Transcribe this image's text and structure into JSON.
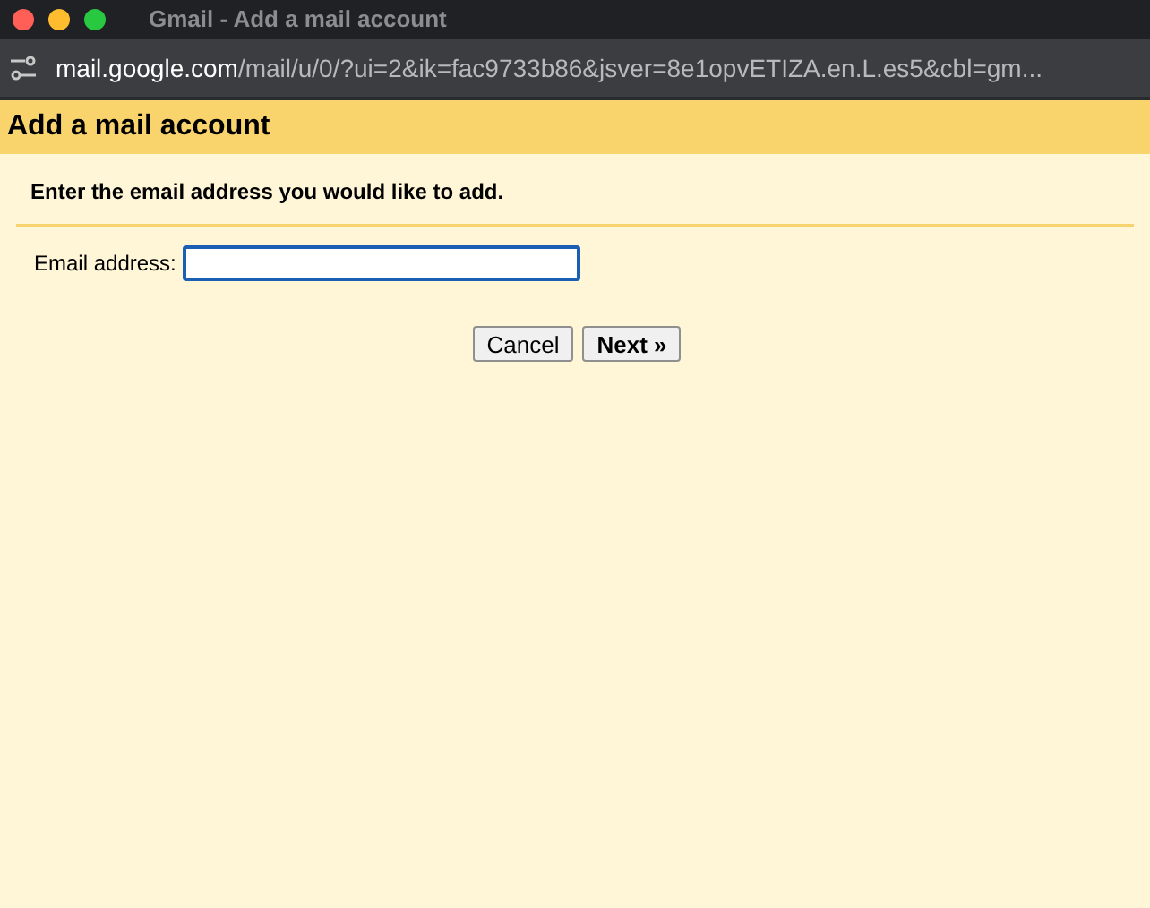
{
  "window": {
    "title": "Gmail - Add a mail account"
  },
  "address_bar": {
    "host": "mail.google.com",
    "path": "/mail/u/0/?ui=2&ik=fac9733b86&jsver=8e1opvETIZA.en.L.es5&cbl=gm..."
  },
  "dialog": {
    "title": "Add a mail account",
    "instruction": "Enter the email address you would like to add.",
    "field": {
      "label": "Email address:",
      "focused": true
    },
    "buttons": [
      {
        "label": "Cancel",
        "kind": "secondary"
      },
      {
        "label": "Next »",
        "kind": "primary"
      }
    ]
  }
}
